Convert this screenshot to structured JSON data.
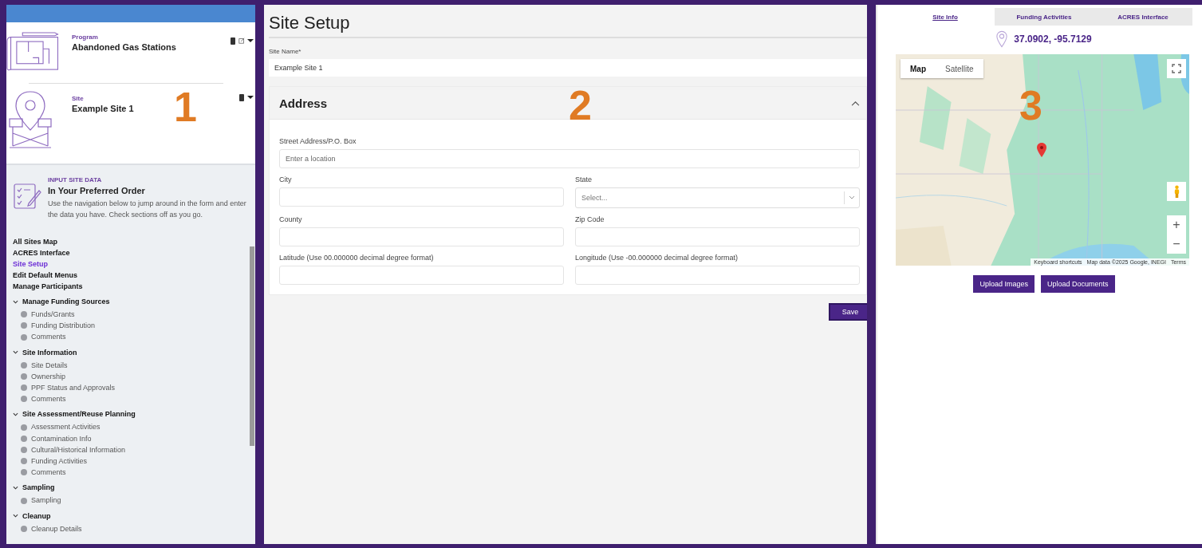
{
  "panel_numbers": [
    "1",
    "2",
    "3"
  ],
  "sidebar": {
    "program": {
      "label": "Program",
      "name": "Abandoned Gas Stations"
    },
    "site": {
      "label": "Site",
      "name": "Example Site 1"
    },
    "intro": {
      "eyebrow": "INPUT SITE DATA",
      "title": "In Your Preferred Order",
      "text": "Use the navigation below to jump around in the form and enter the data you have. Check sections off as you go."
    },
    "nav": [
      {
        "kind": "link",
        "label": "All Sites Map",
        "selected": false
      },
      {
        "kind": "link",
        "label": "ACRES Interface",
        "selected": false
      },
      {
        "kind": "link",
        "label": "Site Setup",
        "selected": true
      },
      {
        "kind": "link",
        "label": "Edit Default Menus",
        "selected": false
      },
      {
        "kind": "link",
        "label": "Manage Participants",
        "selected": false
      },
      {
        "kind": "group",
        "label": "Manage Funding Sources",
        "expanded": true,
        "children": [
          "Funds/Grants",
          "Funding Distribution",
          "Comments"
        ]
      },
      {
        "kind": "group",
        "label": "Site Information",
        "expanded": true,
        "children": [
          "Site Details",
          "Ownership",
          "PPF Status and Approvals",
          "Comments"
        ]
      },
      {
        "kind": "group",
        "label": "Site Assessment/Reuse Planning",
        "expanded": true,
        "children": [
          "Assessment Activities",
          "Contamination Info",
          "Cultural/Historical Information",
          "Funding Activities",
          "Comments"
        ]
      },
      {
        "kind": "group",
        "label": "Sampling",
        "expanded": true,
        "children": [
          "Sampling"
        ]
      },
      {
        "kind": "group",
        "label": "Cleanup",
        "expanded": true,
        "children": [
          "Cleanup Details"
        ]
      }
    ]
  },
  "form": {
    "title": "Site Setup",
    "site_name": {
      "label": "Site Name*",
      "value": "Example Site 1"
    },
    "section": {
      "title": "Address",
      "expanded": true,
      "fields": [
        {
          "kind": "address",
          "label": "Street Address/P.O. Box",
          "placeholder": "Enter a location"
        },
        {
          "kind": "text",
          "label": "City"
        },
        {
          "kind": "select",
          "label": "State",
          "placeholder": "Select..."
        },
        {
          "kind": "text",
          "label": "County"
        },
        {
          "kind": "text",
          "label": "Zip Code"
        },
        {
          "kind": "text",
          "label": "Latitude (Use 00.000000 decimal degree format)"
        },
        {
          "kind": "text",
          "label": "Longitude (Use -00.000000 decimal degree format)"
        }
      ]
    },
    "save_button": "Save"
  },
  "details": {
    "tabs": [
      {
        "label": "Site Info",
        "selected": true
      },
      {
        "label": "Funding Activities",
        "selected": false
      },
      {
        "label": "ACRES Interface",
        "selected": false
      }
    ],
    "coordinates": "37.0902, -95.7129",
    "map": {
      "kind": "picture",
      "types": [
        {
          "label": "Map",
          "selected": true
        },
        {
          "label": "Satellite",
          "selected": false
        }
      ],
      "zoom_in": "+",
      "zoom_out": "−",
      "footer": [
        "Keyboard shortcuts",
        "Map data ©2025 Google, INEGI",
        "Terms"
      ]
    },
    "buttons": [
      "Upload Images",
      "Upload Documents"
    ]
  }
}
